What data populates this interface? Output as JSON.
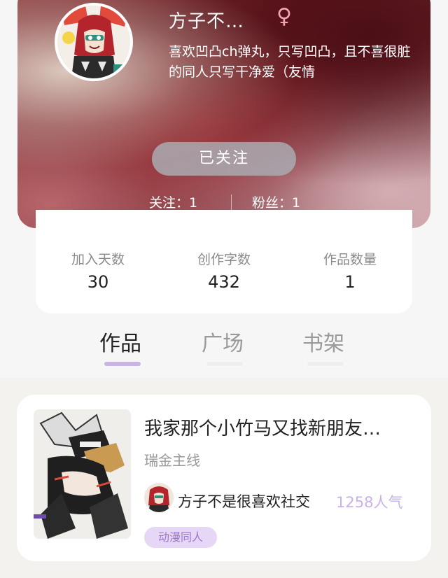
{
  "profile": {
    "name": "方子不…",
    "gender_symbol": "♀",
    "bio": "喜欢凹凸ch弹丸，只写凹凸，且不喜很脏的同人只写干净爱（友情",
    "follow_button": "已关注",
    "following_text": "关注：1",
    "fans_text": "粉丝：1"
  },
  "stats": [
    {
      "label": "加入天数",
      "value": "30"
    },
    {
      "label": "创作字数",
      "value": "432"
    },
    {
      "label": "作品数量",
      "value": "1"
    }
  ],
  "tabs": [
    {
      "label": "作品",
      "active": true
    },
    {
      "label": "广场",
      "active": false
    },
    {
      "label": "书架",
      "active": false
    }
  ],
  "work": {
    "title": "我家那个小竹马又找新朋友…",
    "subtitle": "瑞金主线",
    "author": "方子不是很喜欢社交",
    "popularity": "1258人气",
    "tag": "动漫同人"
  },
  "colors": {
    "accent": "#c8b4e6",
    "popularity": "#c9b1ea",
    "tag_bg": "#e7d7f6",
    "tag_text": "#9b76cf",
    "header_dark": "#6b1b22"
  }
}
